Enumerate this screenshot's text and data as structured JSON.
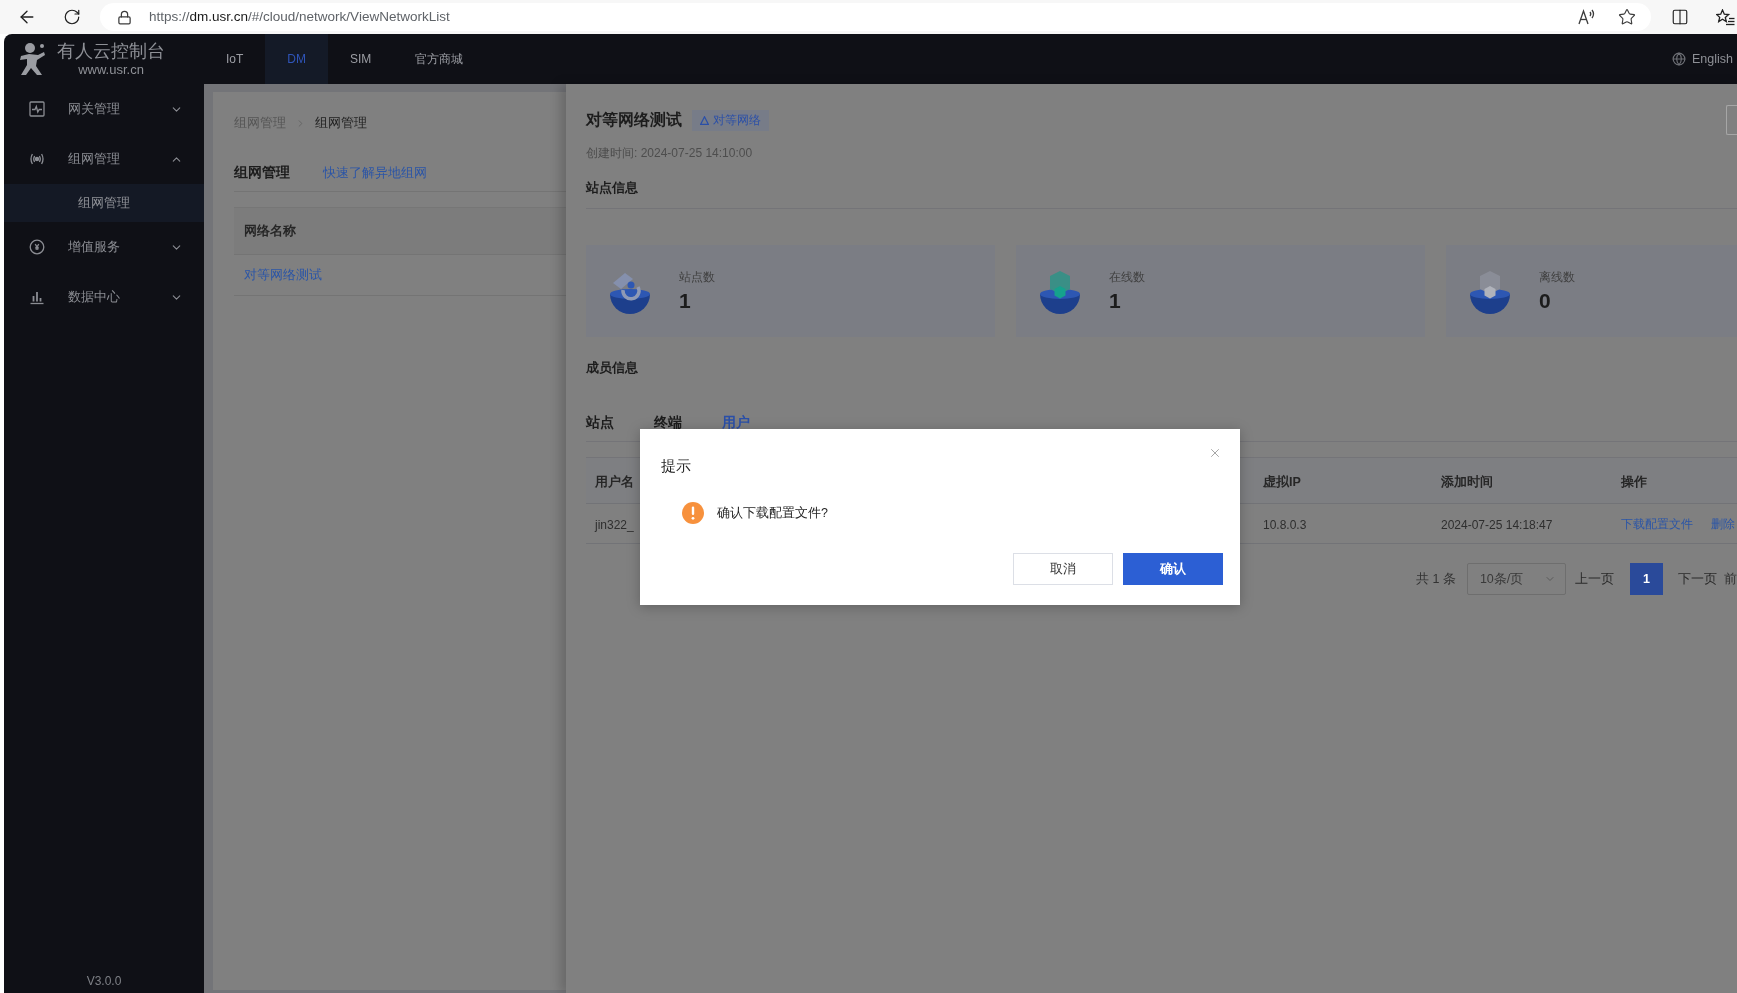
{
  "browser": {
    "url": {
      "scheme": "https://",
      "host": "dm.usr.cn",
      "path": "/#/cloud/network/ViewNetworkList"
    }
  },
  "header": {
    "logo": {
      "title": "有人云控制台",
      "subtitle": "www.usr.cn"
    },
    "tabs": [
      {
        "label": "IoT",
        "selected": false
      },
      {
        "label": "DM",
        "selected": true
      },
      {
        "label": "SIM",
        "selected": false
      },
      {
        "label": "官方商城",
        "selected": false
      }
    ],
    "language": "English"
  },
  "sidebar": {
    "items": [
      {
        "label": "网关管理",
        "expanded": false
      },
      {
        "label": "组网管理",
        "expanded": true,
        "children": [
          {
            "label": "组网管理",
            "selected": true
          }
        ]
      },
      {
        "label": "增值服务",
        "expanded": false
      },
      {
        "label": "数据中心",
        "expanded": false
      }
    ],
    "version": "V3.0.0"
  },
  "network_page": {
    "breadcrumb": [
      "组网管理",
      "组网管理"
    ],
    "title": "组网管理",
    "link": "快速了解异地组网",
    "table": {
      "columns": [
        "网络名称"
      ],
      "rows": [
        [
          "对等网络测试"
        ]
      ]
    }
  },
  "drawer": {
    "title": "对等网络测试",
    "tag": "对等网络",
    "created": "创建时间: 2024-07-25 14:10:00",
    "site_info_title": "站点信息",
    "stats": [
      {
        "label": "站点数",
        "value": "1"
      },
      {
        "label": "在线数",
        "value": "1"
      },
      {
        "label": "离线数",
        "value": "0"
      }
    ],
    "member_info_title": "成员信息",
    "tabs": [
      {
        "label": "站点",
        "selected": false
      },
      {
        "label": "终端",
        "selected": false
      },
      {
        "label": "用户",
        "selected": true
      }
    ],
    "table": {
      "columns": [
        "用户名",
        "虚拟IP",
        "添加时间",
        "操作"
      ],
      "rows": [
        {
          "cells": [
            "jin322_",
            "10.8.0.3",
            "2024-07-25 14:18:47"
          ],
          "actions": [
            "下载配置文件",
            "删除"
          ]
        }
      ]
    },
    "pagination": {
      "total": "共 1 条",
      "page_size": "10条/页",
      "prev": "上一页",
      "pages": [
        {
          "label": "1",
          "selected": true
        }
      ],
      "next": "下一页",
      "jump": "前"
    }
  },
  "dialog": {
    "title": "提示",
    "message": "确认下载配置文件?",
    "buttons": [
      {
        "label": "取消",
        "kind": "secondary"
      },
      {
        "label": "确认",
        "kind": "primary"
      }
    ]
  }
}
